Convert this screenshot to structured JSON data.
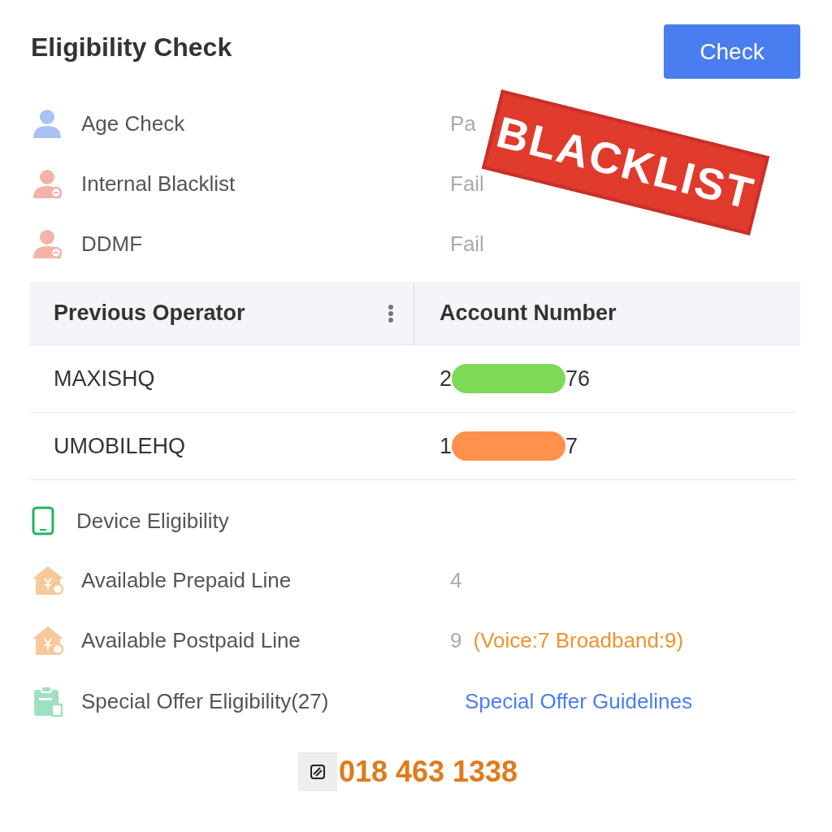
{
  "title": "Eligibility Check",
  "check_button": "Check",
  "checks": [
    {
      "label": "Age Check",
      "value": "Pa",
      "kind": "pass"
    },
    {
      "label": "Internal Blacklist",
      "value": "Fail",
      "kind": "fail"
    },
    {
      "label": "DDMF",
      "value": "Fail",
      "kind": "fail"
    }
  ],
  "stamp": "BLACKLIST",
  "table": {
    "columns": [
      "Previous Operator",
      "Account Number"
    ],
    "rows": [
      {
        "operator": "MAXISHQ",
        "account_start": "2",
        "account_end": "76",
        "color": "#7ed957"
      },
      {
        "operator": "UMOBILEHQ",
        "account_start": "1",
        "account_end": "7",
        "color": "#ff914d"
      }
    ]
  },
  "device_eligibility": "Device Eligibility",
  "lines": [
    {
      "label": "Available Prepaid Line",
      "value": "4"
    },
    {
      "label": "Available Postpaid Line",
      "value": "9",
      "note": "(Voice:7 Broadband:9)"
    }
  ],
  "special_offer": {
    "label": "Special Offer Eligibility(27)",
    "link": "Special Offer Guidelines"
  },
  "contact": {
    "phone": "018 463 1338"
  }
}
